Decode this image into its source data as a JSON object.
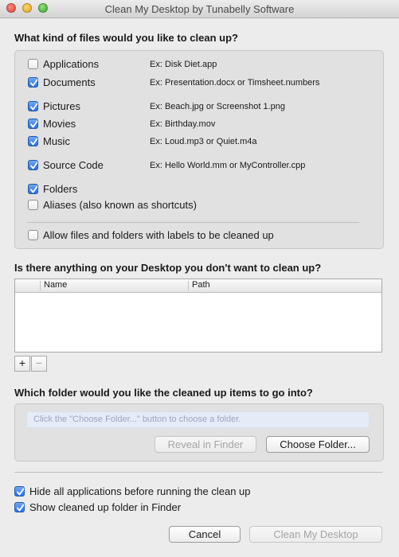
{
  "window": {
    "title": "Clean My Desktop by Tunabelly Software"
  },
  "file_types": {
    "heading": "What kind of files would you like to clean up?",
    "items": [
      {
        "label": "Applications",
        "example": "Ex: Disk Diet.app",
        "checked": false
      },
      {
        "label": "Documents",
        "example": "Ex: Presentation.docx or Timsheet.numbers",
        "checked": true
      },
      {
        "label": "Pictures",
        "example": "Ex: Beach.jpg or Screenshot 1.png",
        "checked": true
      },
      {
        "label": "Movies",
        "example": "Ex: Birthday.mov",
        "checked": true
      },
      {
        "label": "Music",
        "example": "Ex: Loud.mp3 or Quiet.m4a",
        "checked": true
      },
      {
        "label": "Source Code",
        "example": "Ex: Hello World.mm or MyController.cpp",
        "checked": true
      },
      {
        "label": "Folders",
        "example": "",
        "checked": true
      },
      {
        "label": "Aliases (also known as shortcuts)",
        "example": "",
        "checked": false
      }
    ],
    "allow_labels": {
      "label": "Allow files and folders with labels to be cleaned up",
      "checked": false
    }
  },
  "exclusions": {
    "heading": "Is there anything on your Desktop you don't want to clean up?",
    "columns": [
      "Name",
      "Path"
    ],
    "add_label": "+",
    "remove_label": "−"
  },
  "destination": {
    "heading": "Which folder would you like the cleaned up items to go into?",
    "placeholder": "Click the \"Choose Folder...\" button to choose a folder.",
    "reveal_label": "Reveal in Finder",
    "choose_label": "Choose Folder..."
  },
  "options": {
    "hide_apps": {
      "label": "Hide all applications before running the clean up",
      "checked": true
    },
    "show_folder": {
      "label": "Show cleaned up folder in Finder",
      "checked": true
    }
  },
  "footer": {
    "cancel_label": "Cancel",
    "clean_label": "Clean My Desktop"
  },
  "colors": {
    "accent": "#2b72e0",
    "window_bg": "#ececec",
    "group_bg": "#e1e1e1"
  }
}
